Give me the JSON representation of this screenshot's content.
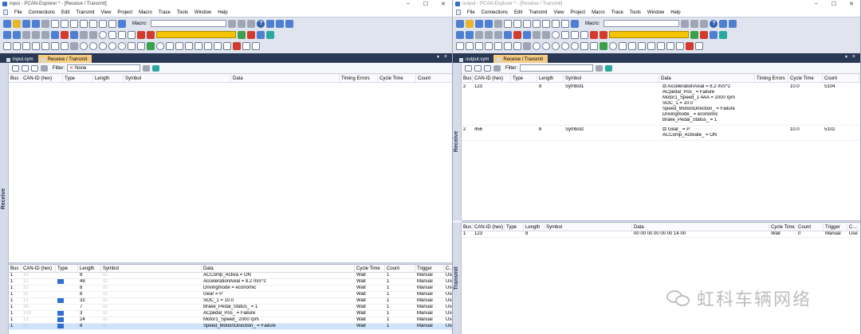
{
  "left": {
    "title": "input - PCAN-Explorer * - [Receive / Transmit]",
    "menu": [
      "File",
      "Connections",
      "Edit",
      "Transmit",
      "View",
      "Project",
      "Macro",
      "Trace",
      "Tools",
      "Window",
      "Help"
    ],
    "macro_label": "Macro:",
    "tabs": [
      "input.sym",
      "Receive / Transmit"
    ],
    "filter_label": "Filter:",
    "filter_value": "None",
    "sidebar_label": "Receive",
    "rx_columns": [
      "Bus",
      "CAN-ID (hex)",
      "Type",
      "Length",
      "Symbol",
      "Data",
      "Timing Errors",
      "Cycle Time",
      "Count"
    ],
    "tx_columns": [
      "Bus",
      "CAN-ID (hex)",
      "Type",
      "Length",
      "Symbol",
      "Data",
      "Cycle Time",
      "Count",
      "Trigger",
      "C..."
    ],
    "tx_rows": [
      {
        "bus": "1",
        "id": "10",
        "len": "8",
        "sym": "ID",
        "data": "ACComp_Activa  = ON",
        "cycle": "Wait",
        "count": "1",
        "trigger": "Manual",
        "c": "User",
        "pill": false,
        "sel": false
      },
      {
        "bus": "1",
        "id": "12",
        "len": "48",
        "sym": "ID",
        "data": "AccelerationAxial  = 8.2 m/s^2",
        "cycle": "Wait",
        "count": "1",
        "trigger": "Manual",
        "c": "User",
        "pill": true,
        "sel": false
      },
      {
        "bus": "1",
        "id": "32",
        "len": "8",
        "sym": "ID",
        "data": "Drivingmode  = economic",
        "cycle": "Wait",
        "count": "1",
        "trigger": "Manual",
        "c": "User",
        "pill": false,
        "sel": false
      },
      {
        "bus": "1",
        "id": "35",
        "len": "8",
        "sym": "ID",
        "data": "Gear  = P",
        "cycle": "Wait",
        "count": "1",
        "trigger": "Manual",
        "c": "User",
        "pill": false,
        "sel": false
      },
      {
        "bus": "1",
        "id": "14",
        "len": "32",
        "sym": "ID",
        "data": "SOC_1  = 10.0",
        "cycle": "Wait",
        "count": "1",
        "trigger": "Manual",
        "c": "User",
        "pill": true,
        "sel": false
      },
      {
        "bus": "1",
        "id": "38",
        "len": "7",
        "sym": "ID",
        "data": "Brake_Pedal_Status_  = 1",
        "cycle": "Wait",
        "count": "1",
        "trigger": "Manual",
        "c": "User",
        "pill": false,
        "sel": false
      },
      {
        "bus": "1",
        "id": "100",
        "len": "3",
        "sym": "ID",
        "data": "ACpedal_Pos_  = Failure",
        "cycle": "Wait",
        "count": "1",
        "trigger": "Manual",
        "c": "User",
        "pill": true,
        "sel": false
      },
      {
        "bus": "1",
        "id": "12",
        "len": "24",
        "sym": "ID",
        "data": "Motor1_Speed_  2000 rpm",
        "cycle": "Wait",
        "count": "1",
        "trigger": "Manual",
        "c": "User",
        "pill": true,
        "sel": false
      },
      {
        "bus": "1",
        "id": "20",
        "len": "8",
        "sym": "ID",
        "data": "Speed_MotionDirection_  = Failure",
        "cycle": "Wait",
        "count": "1",
        "trigger": "Manual",
        "c": "User",
        "pill": true,
        "sel": true
      }
    ]
  },
  "right": {
    "title": "output - PCAN-Explorer * - [Receive / Transmit]",
    "menu": [
      "File",
      "Connections",
      "Edit",
      "Transmit",
      "View",
      "Project",
      "Macro",
      "Trace",
      "Tools",
      "Window",
      "Help"
    ],
    "macro_label": "Macro:",
    "tabs": [
      "output.sym",
      "Receive / Transmit"
    ],
    "filter_label": "Filter:",
    "sidebar_label": "Receive",
    "sidebar_label_tx": "Transmit",
    "rx_columns": [
      "Bus",
      "CAN-ID (hex)",
      "Type",
      "Length",
      "Symbol",
      "Data",
      "Timing Errors",
      "Cycle Time",
      "Count"
    ],
    "rx_rows": [
      {
        "bus": "2",
        "id": "123",
        "len": "8",
        "sym": "Symbol1",
        "cycle": "10.0",
        "count": "5104",
        "data": [
          "AccelerationAxial  = 8.2 m/s^2",
          "ACpedal_Pos_  = Failure",
          "Motor1_Speed_1  4AA = 2000 rpm",
          "SOC_1  = 10.0",
          "Speed_MotionDirection_  = Failure",
          "Drivingmode_  = economic",
          "Brake_Pedal_Status_  = 1"
        ]
      },
      {
        "bus": "2",
        "id": "456",
        "len": "8",
        "sym": "Symbol2",
        "cycle": "10.0",
        "count": "5102",
        "data": [
          "Gear_  = P",
          "ACComp_Activate_  = ON"
        ]
      }
    ],
    "tx_columns": [
      "Bus",
      "CAN-ID (hex)",
      "Type",
      "Length",
      "Symbol",
      "Data",
      "Cycle Time",
      "Count",
      "Trigger",
      "C..."
    ],
    "tx_rows": [
      {
        "bus": "1",
        "id": "123",
        "len": "8",
        "sym": "",
        "data": "00 00 00 00 00 00 14 00",
        "cycle": "Wait",
        "count": "0",
        "trigger": "Manual",
        "c": "User"
      }
    ]
  },
  "watermark": "虹科车辆网络",
  "colors": {
    "tab_bar": "#293955",
    "active_tab": "#f5cc84",
    "selection": "#cfe3fb",
    "toolbar": "#dfe4ee"
  }
}
